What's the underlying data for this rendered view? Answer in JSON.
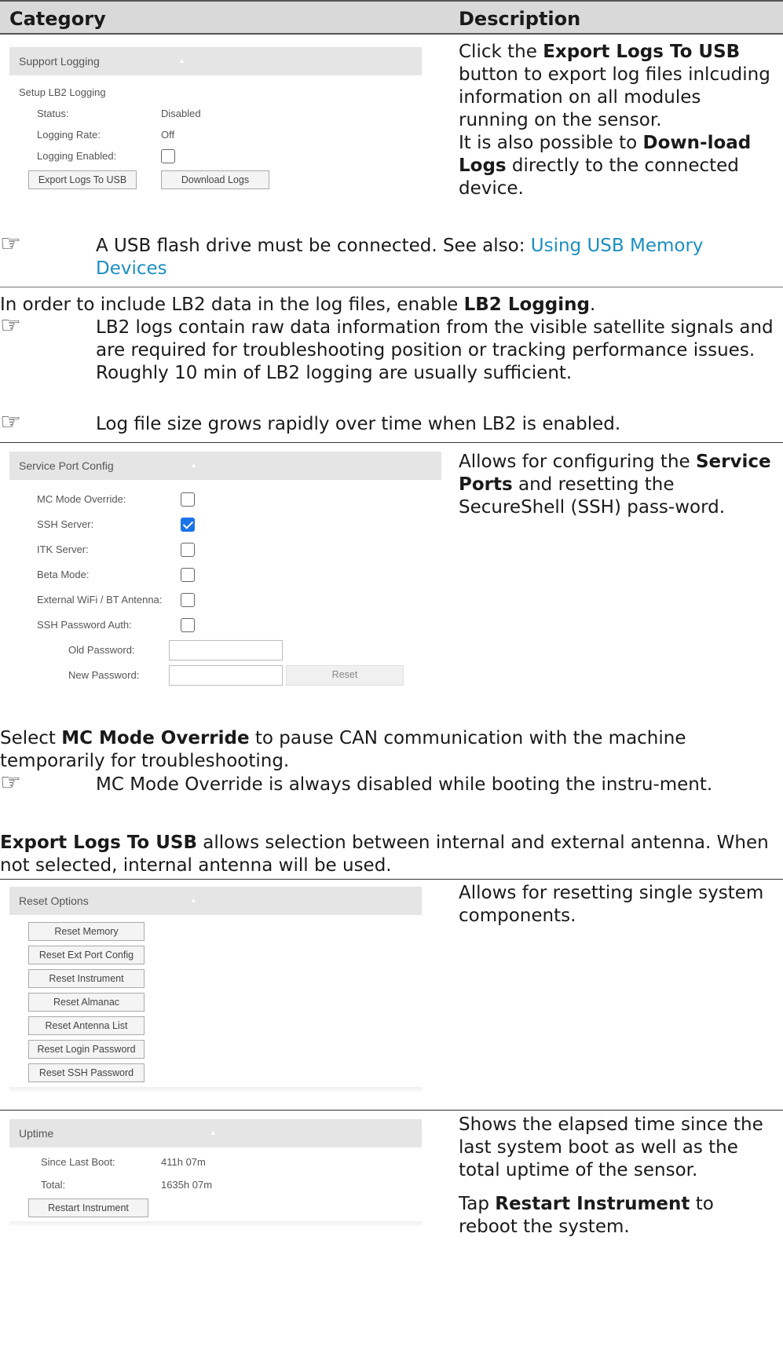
{
  "header": {
    "category": "Category",
    "description": "Description"
  },
  "support_logging": {
    "title": "Support Logging",
    "section": "Setup LB2 Logging",
    "status_label": "Status:",
    "status_value": "Disabled",
    "rate_label": "Logging Rate:",
    "rate_value": "Off",
    "enabled_label": "Logging Enabled:",
    "enabled_checked": false,
    "export_button": "Export Logs To USB",
    "download_button": "Download Logs",
    "desc_1a": "Click the ",
    "desc_1b": "Export Logs To USB",
    "desc_1c": " button to export log files inlcuding information on all modules running on the sensor.",
    "desc_2a": "It is also possible to ",
    "desc_2b": "Down-load Logs",
    "desc_2c": " directly to the connected device."
  },
  "note_usb": {
    "text": "A USB flash drive must be connected. See also: ",
    "link": "Using USB Memory Devices"
  },
  "lb2_para": {
    "a": "In order to include LB2 data in the log files, enable ",
    "b": "LB2 Logging",
    "c": "."
  },
  "note_lb2": "LB2 logs contain raw data information from the visible satellite signals and are required for troubleshooting position or tracking performance issues. Roughly 10 min of LB2 logging are usually sufficient.",
  "note_size": "Log file size grows rapidly over time when LB2 is enabled.",
  "service_port": {
    "title": "Service Port Config",
    "rows": [
      {
        "label": "MC Mode Override:",
        "checked": false
      },
      {
        "label": "SSH Server:",
        "checked": true
      },
      {
        "label": "ITK Server:",
        "checked": false
      },
      {
        "label": "Beta Mode:",
        "checked": false
      },
      {
        "label": "External WiFi / BT Antenna:",
        "checked": false
      },
      {
        "label": "SSH Password Auth:",
        "checked": false
      }
    ],
    "old_password_label": "Old Password:",
    "new_password_label": "New Password:",
    "reset_button": "Reset",
    "desc_a": "Allows for configuring the ",
    "desc_b": "Service Ports",
    "desc_c": " and resetting the SecureShell (SSH) pass-word."
  },
  "mc_para": {
    "a": "MC Mode Override",
    "b": " to pause CAN communication with the machine temporarily for troubleshooting.",
    "pre": "Select "
  },
  "note_mc": "MC Mode Override is always disabled while booting the instru-ment.",
  "export_para": {
    "a": "Export Logs To USB",
    "b": " allows selection between internal and external antenna. When not selected, internal antenna will be used."
  },
  "reset_options": {
    "title": "Reset Options",
    "buttons": [
      "Reset Memory",
      "Reset Ext Port Config",
      "Reset Instrument",
      "Reset Almanac",
      "Reset Antenna List",
      "Reset Login Password",
      "Reset SSH Password"
    ],
    "desc": "Allows for resetting single system components."
  },
  "uptime": {
    "title": "Uptime",
    "since_label": "Since Last Boot:",
    "since_value": "411h 07m",
    "total_label": "Total:",
    "total_value": "1635h 07m",
    "restart_button": "Restart Instrument",
    "desc_1": "Shows the elapsed time since the last system boot as well as the total uptime of the sensor.",
    "desc_2a": "Tap ",
    "desc_2b": "Restart Instrument",
    "desc_2c": " to reboot the system."
  }
}
